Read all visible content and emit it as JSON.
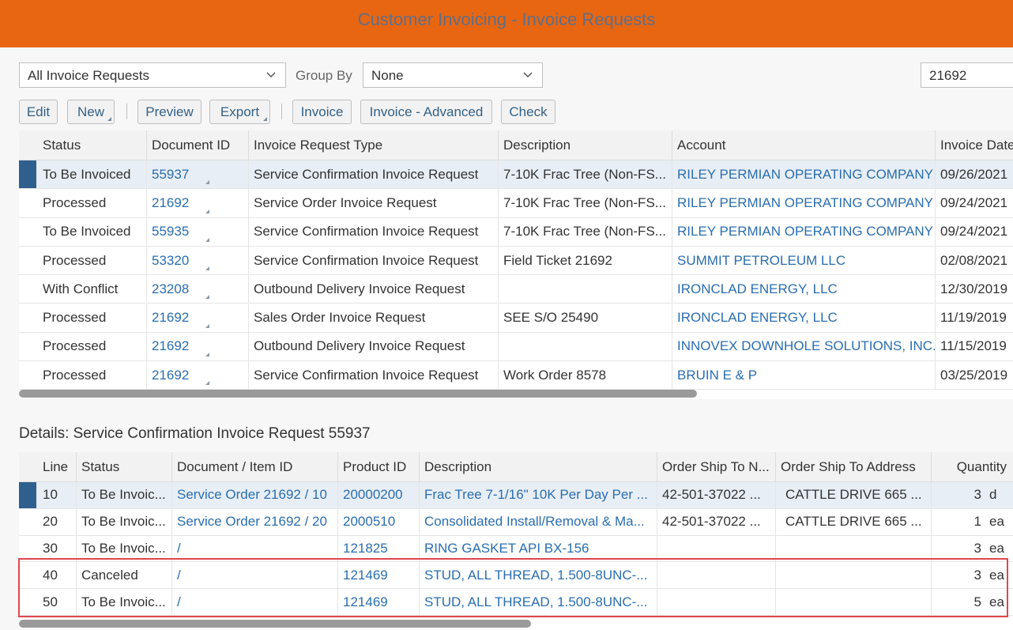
{
  "app": {
    "title": "Customer Invoicing - Invoice Requests"
  },
  "filters": {
    "view_select": "All Invoice Requests",
    "group_by_label": "Group By",
    "group_by_select": "None",
    "search_value": "21692"
  },
  "toolbar": {
    "edit": "Edit",
    "new": "New",
    "preview": "Preview",
    "export": "Export",
    "invoice": "Invoice",
    "invoice_advanced": "Invoice - Advanced",
    "check": "Check"
  },
  "main_table": {
    "columns": [
      "Status",
      "Document ID",
      "Invoice Request Type",
      "Description",
      "Account",
      "Invoice Date"
    ],
    "rows": [
      {
        "status": "To Be Invoiced",
        "document_id": "55937",
        "type": "Service Confirmation Invoice Request",
        "description": "7-10K Frac Tree (Non-FS...",
        "account": "RILEY PERMIAN OPERATING COMPANY",
        "date": "09/26/2021"
      },
      {
        "status": "Processed",
        "document_id": "21692",
        "type": "Service Order Invoice Request",
        "description": "7-10K Frac Tree (Non-FS...",
        "account": "RILEY PERMIAN OPERATING COMPANY",
        "date": "09/24/2021"
      },
      {
        "status": "To Be Invoiced",
        "document_id": "55935",
        "type": "Service Confirmation Invoice Request",
        "description": "7-10K Frac Tree (Non-FS...",
        "account": "RILEY PERMIAN OPERATING COMPANY",
        "date": "09/24/2021"
      },
      {
        "status": "Processed",
        "document_id": "53320",
        "type": "Service Confirmation Invoice Request",
        "description": "Field Ticket 21692",
        "account": "SUMMIT PETROLEUM LLC",
        "date": "02/08/2021"
      },
      {
        "status": "With Conflict",
        "document_id": "23208",
        "type": "Outbound Delivery Invoice Request",
        "description": "",
        "account": "IRONCLAD ENERGY, LLC",
        "date": "12/30/2019"
      },
      {
        "status": "Processed",
        "document_id": "21692",
        "type": "Sales Order Invoice Request",
        "description": "SEE S/O 25490",
        "account": "IRONCLAD ENERGY, LLC",
        "date": "11/19/2019"
      },
      {
        "status": "Processed",
        "document_id": "21692",
        "type": "Outbound Delivery Invoice Request",
        "description": "",
        "account": "INNOVEX DOWNHOLE SOLUTIONS, INC.",
        "date": "11/15/2019"
      },
      {
        "status": "Processed",
        "document_id": "21692",
        "type": "Service Confirmation Invoice Request",
        "description": "Work Order 8578",
        "account": "BRUIN E & P",
        "date": "03/25/2019"
      }
    ]
  },
  "details": {
    "title": "Details: Service Confirmation Invoice Request 55937",
    "columns": [
      "Line",
      "Status",
      "Document / Item ID",
      "Product ID",
      "Description",
      "Order Ship To N...",
      "Order Ship To Address",
      "Quantity"
    ],
    "rows": [
      {
        "line": "10",
        "status": "To Be Invoic...",
        "item_id": "Service Order 21692 / 10",
        "product_id": "20000200",
        "description": "Frac Tree 7-1/16\" 10K Per Day Per ...",
        "ship_to_name": "42-501-37022 ...",
        "ship_to_address": "CATTLE DRIVE 665 ...",
        "quantity": "3",
        "unit": "d"
      },
      {
        "line": "20",
        "status": "To Be Invoic...",
        "item_id": "Service Order 21692 / 20",
        "product_id": "2000510",
        "description": "Consolidated Install/Removal & Ma...",
        "ship_to_name": "42-501-37022 ...",
        "ship_to_address": "CATTLE DRIVE 665 ...",
        "quantity": "1",
        "unit": "ea"
      },
      {
        "line": "30",
        "status": "To Be Invoic...",
        "item_id": "/",
        "product_id": "121825",
        "description": "RING GASKET API BX-156",
        "ship_to_name": "",
        "ship_to_address": "",
        "quantity": "3",
        "unit": "ea"
      },
      {
        "line": "40",
        "status": "Canceled",
        "item_id": "/",
        "product_id": "121469",
        "description": "STUD, ALL THREAD, 1.500-8UNC-...",
        "ship_to_name": "",
        "ship_to_address": "",
        "quantity": "3",
        "unit": "ea"
      },
      {
        "line": "50",
        "status": "To Be Invoic...",
        "item_id": "/",
        "product_id": "121469",
        "description": "STUD, ALL THREAD, 1.500-8UNC-...",
        "ship_to_name": "",
        "ship_to_address": "",
        "quantity": "5",
        "unit": "ea"
      }
    ]
  },
  "colors": {
    "header_bar": "#e86612",
    "title_text": "#5f6e87",
    "link": "#2a6eb0",
    "selection_marker": "#2f5f8d",
    "highlight_box": "#e0474f"
  }
}
